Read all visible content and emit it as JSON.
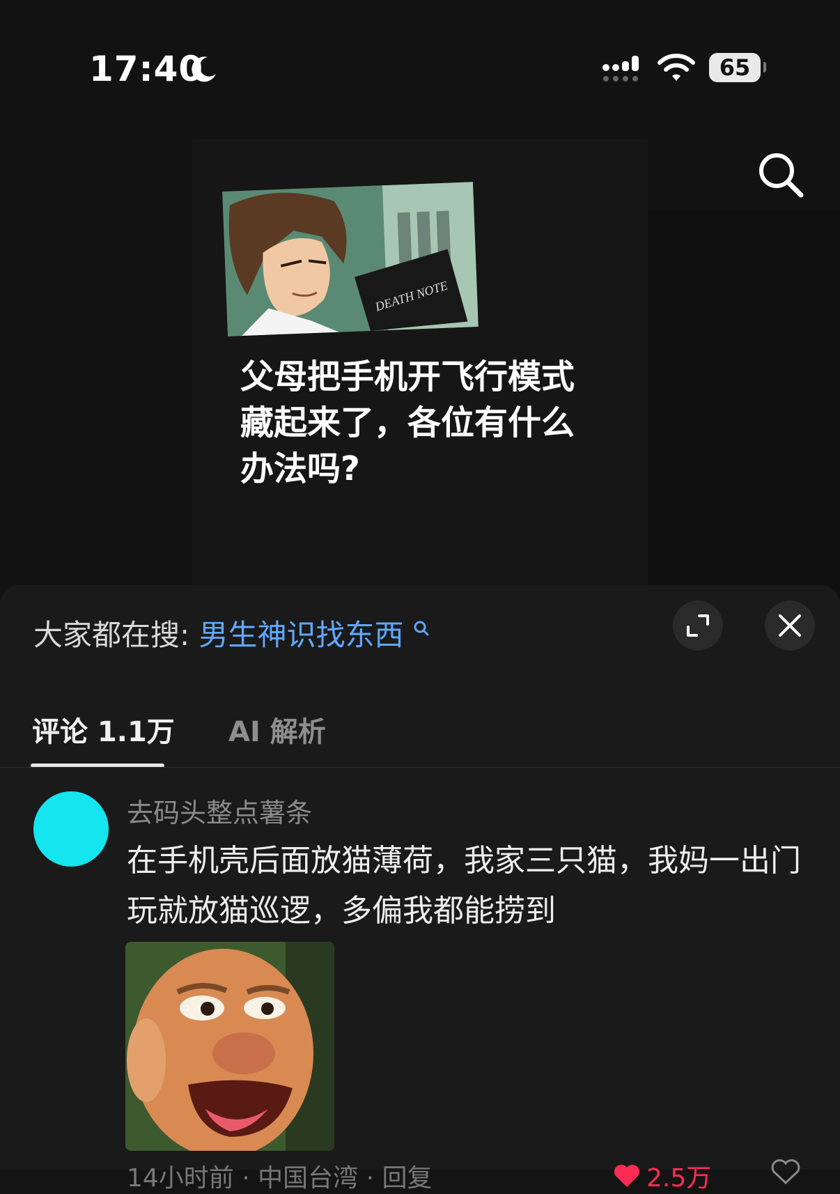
{
  "status_bar": {
    "time": "17:40",
    "battery": "65",
    "icons": [
      "moon-icon",
      "signal-icon",
      "wifi-icon",
      "battery-icon"
    ]
  },
  "video": {
    "caption": "父母把手机开飞行模式\n藏起来了，各位有什么\n办法吗?",
    "book_text": "DEATH NOTE",
    "search_icon": "search-icon"
  },
  "panel": {
    "hot_search_label": "大家都在搜:",
    "hot_search_term": "男生神识找东西",
    "expand_icon": "expand-icon",
    "close_icon": "close-icon",
    "tabs": [
      {
        "label": "评论 1.1万",
        "active": true
      },
      {
        "label": "AI 解析",
        "active": false
      }
    ]
  },
  "comment": {
    "avatar_color": "#14e5ef",
    "username": "去码头整点薯条",
    "text": "在手机壳后面放猫薄荷，我家三只猫，我妈一出门玩就放猫巡逻，多偏我都能捞到",
    "meta": "14小时前 · 中国台湾 · 回复",
    "likes": "2.5万"
  },
  "colors": {
    "accent_link": "#5fa8ff",
    "like_red": "#fe2c55",
    "panel_bg": "#1a1a1a"
  }
}
